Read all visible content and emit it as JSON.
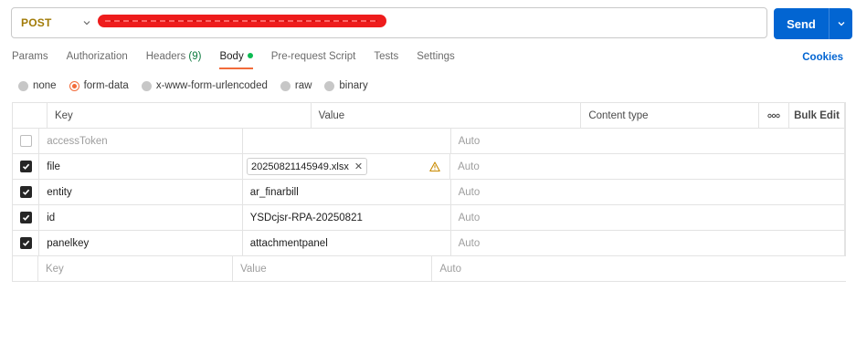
{
  "request": {
    "method": "POST",
    "send_label": "Send"
  },
  "tabs": [
    {
      "label": "Params"
    },
    {
      "label": "Authorization"
    },
    {
      "label": "Headers",
      "count": "(9)"
    },
    {
      "label": "Body",
      "active": true
    },
    {
      "label": "Pre-request Script"
    },
    {
      "label": "Tests"
    },
    {
      "label": "Settings"
    }
  ],
  "cookies_label": "Cookies",
  "body_modes": [
    {
      "label": "none",
      "checked": false
    },
    {
      "label": "form-data",
      "checked": true
    },
    {
      "label": "x-www-form-urlencoded",
      "checked": false
    },
    {
      "label": "raw",
      "checked": false
    },
    {
      "label": "binary",
      "checked": false
    }
  ],
  "table": {
    "headers": {
      "key": "Key",
      "value": "Value",
      "content_type": "Content type",
      "bulk_edit": "Bulk Edit"
    },
    "rows": [
      {
        "checked": false,
        "key": "accessToken",
        "value": "",
        "content_type": "Auto"
      },
      {
        "checked": true,
        "key": "file",
        "value": "20250821145949.xlsx",
        "is_file": true,
        "content_type": "Auto"
      },
      {
        "checked": true,
        "key": "entity",
        "value": "ar_finarbill",
        "content_type": "Auto"
      },
      {
        "checked": true,
        "key": "id",
        "value": "YSDcjsr-RPA-20250821",
        "content_type": "Auto"
      },
      {
        "checked": true,
        "key": "panelkey",
        "value": "attachmentpanel",
        "content_type": "Auto"
      }
    ],
    "placeholder": {
      "key": "Key",
      "value": "Value",
      "content_type": "Auto"
    }
  },
  "colors": {
    "method": "#a17b07",
    "send": "#0265d2",
    "accent": "#f26b3a",
    "redaction": "#ee1c1c"
  }
}
